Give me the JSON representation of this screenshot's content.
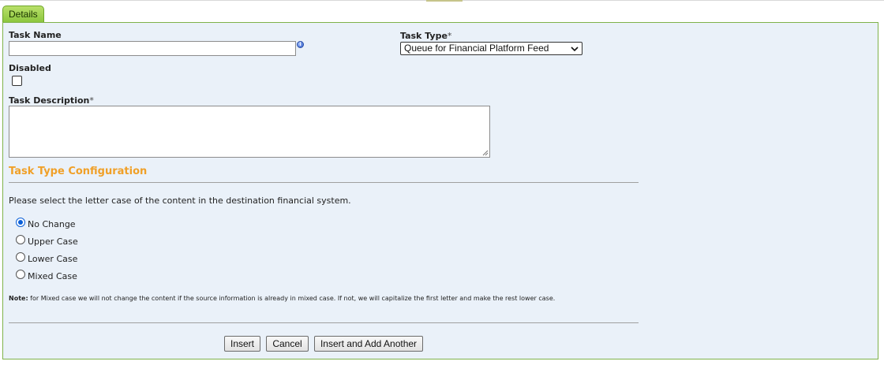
{
  "tab": {
    "label": "Details"
  },
  "form": {
    "task_name": {
      "label": "Task Name",
      "value": "",
      "info_icon": "info-icon"
    },
    "task_type": {
      "label": "Task Type",
      "required_mark": "*",
      "selected": "Queue for Financial Platform Feed",
      "icon": "chevron-down-icon"
    },
    "disabled": {
      "label": "Disabled",
      "checked": false
    },
    "task_description": {
      "label": "Task Description",
      "required_mark": "*",
      "value": ""
    }
  },
  "config": {
    "title": "Task Type Configuration",
    "instructions": "Please select the letter case of the content in the destination financial system.",
    "options": [
      {
        "label": "No Change",
        "checked": true
      },
      {
        "label": "Upper Case",
        "checked": false
      },
      {
        "label": "Lower Case",
        "checked": false
      },
      {
        "label": "Mixed Case",
        "checked": false
      }
    ],
    "note_label": "Note:",
    "note_text": " for Mixed case we will not change the content if the source information is already in mixed case. If not, we will capitalize the first letter and make the rest lower case."
  },
  "buttons": {
    "insert": "Insert",
    "cancel": "Cancel",
    "insert_add_another": "Insert and Add Another"
  },
  "colors": {
    "tab_green": "#8cc63e",
    "panel_bg": "#eaf1f9",
    "section_title": "#f0a028",
    "radio_selected": "#0a5fd8"
  }
}
